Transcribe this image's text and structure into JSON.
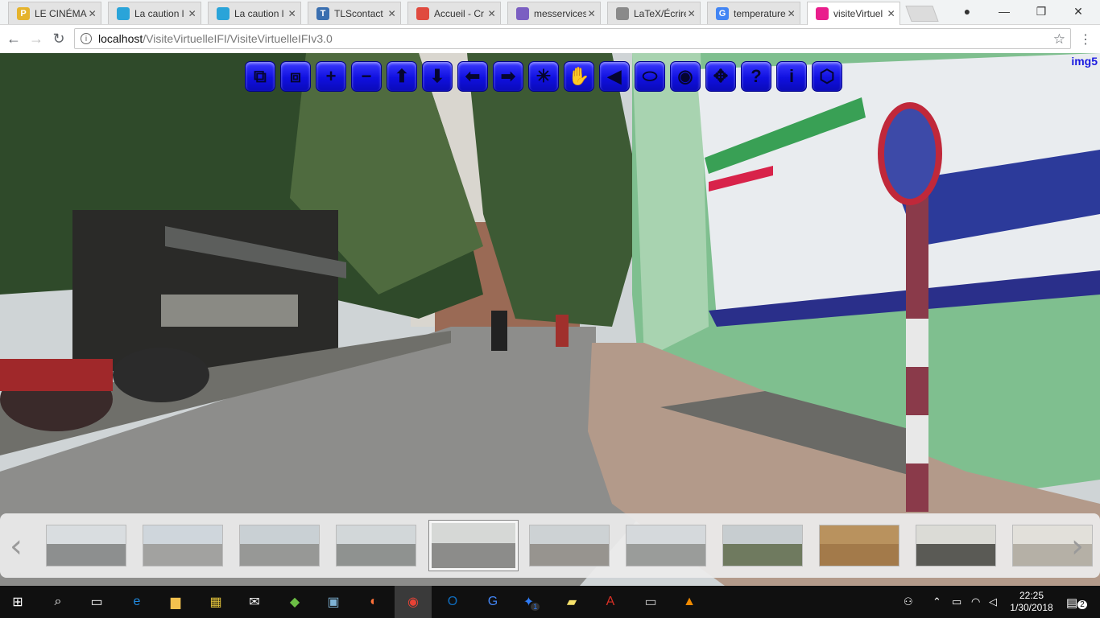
{
  "browser": {
    "tabs": [
      {
        "title": "LE CINÉMA",
        "favicon": "P",
        "color": "#e5b32c"
      },
      {
        "title": "La caution l",
        "favicon": "",
        "color": "#2aa4d9"
      },
      {
        "title": "La caution l",
        "favicon": "",
        "color": "#2aa4d9"
      },
      {
        "title": "TLScontact",
        "favicon": "T",
        "color": "#3a6fb0"
      },
      {
        "title": "Accueil - Cr",
        "favicon": "",
        "color": "#e04a3f"
      },
      {
        "title": "messervices",
        "favicon": "",
        "color": "#7b5fc2"
      },
      {
        "title": "LaTeX/Écrire",
        "favicon": "",
        "color": "#8a8a8a"
      },
      {
        "title": "temperature",
        "favicon": "G",
        "color": "#4285f4"
      },
      {
        "title": "visiteVirtuel",
        "favicon": "",
        "color": "#e91e8c"
      }
    ],
    "url_host": "localhost",
    "url_path": "/VisiteVirtuelleIFI/VisiteVirtuelleIFIv3.0"
  },
  "viewer": {
    "image_label": "img5",
    "controls": [
      {
        "name": "fullscreen-enter-icon",
        "glyph": "⧉"
      },
      {
        "name": "fullscreen-exit-icon",
        "glyph": "⧈"
      },
      {
        "name": "zoom-in-icon",
        "glyph": "+"
      },
      {
        "name": "zoom-out-icon",
        "glyph": "−"
      },
      {
        "name": "move-up-icon",
        "glyph": "⬆"
      },
      {
        "name": "move-down-icon",
        "glyph": "⬇"
      },
      {
        "name": "move-left-icon",
        "glyph": "⬅"
      },
      {
        "name": "move-right-icon",
        "glyph": "➡"
      },
      {
        "name": "autorotate-icon",
        "glyph": "✳"
      },
      {
        "name": "hand-drag-icon",
        "glyph": "✋"
      },
      {
        "name": "sound-icon",
        "glyph": "◀"
      },
      {
        "name": "hotspots-icon",
        "glyph": "⬭"
      },
      {
        "name": "audio-play-icon",
        "glyph": "◉"
      },
      {
        "name": "fit-screen-icon",
        "glyph": "✥"
      },
      {
        "name": "help-icon",
        "glyph": "?"
      },
      {
        "name": "info-icon",
        "glyph": "i"
      },
      {
        "name": "vr-mode-icon",
        "glyph": "⬡"
      }
    ],
    "thumbnails": [
      {
        "sky": "#d9dde0",
        "ground": "#8d8f8f"
      },
      {
        "sky": "#cfd6dc",
        "ground": "#a2a2a0"
      },
      {
        "sky": "#c9d0d4",
        "ground": "#979896"
      },
      {
        "sky": "#d2d7d9",
        "ground": "#8f9290"
      },
      {
        "sky": "#d6d8d6",
        "ground": "#8c8c8a",
        "selected": true
      },
      {
        "sky": "#cdd2d4",
        "ground": "#97948f"
      },
      {
        "sky": "#d5d9dc",
        "ground": "#9a9c9a"
      },
      {
        "sky": "#c7cdd0",
        "ground": "#6f7a5f"
      },
      {
        "sky": "#b9925e",
        "ground": "#a37a4a"
      },
      {
        "sky": "#dbdbd6",
        "ground": "#5a5a55"
      },
      {
        "sky": "#e2e0da",
        "ground": "#b5b0a6"
      }
    ]
  },
  "taskbar": {
    "time": "22:25",
    "date": "1/30/2018",
    "notification_count": "2",
    "messenger_badge": "1"
  }
}
